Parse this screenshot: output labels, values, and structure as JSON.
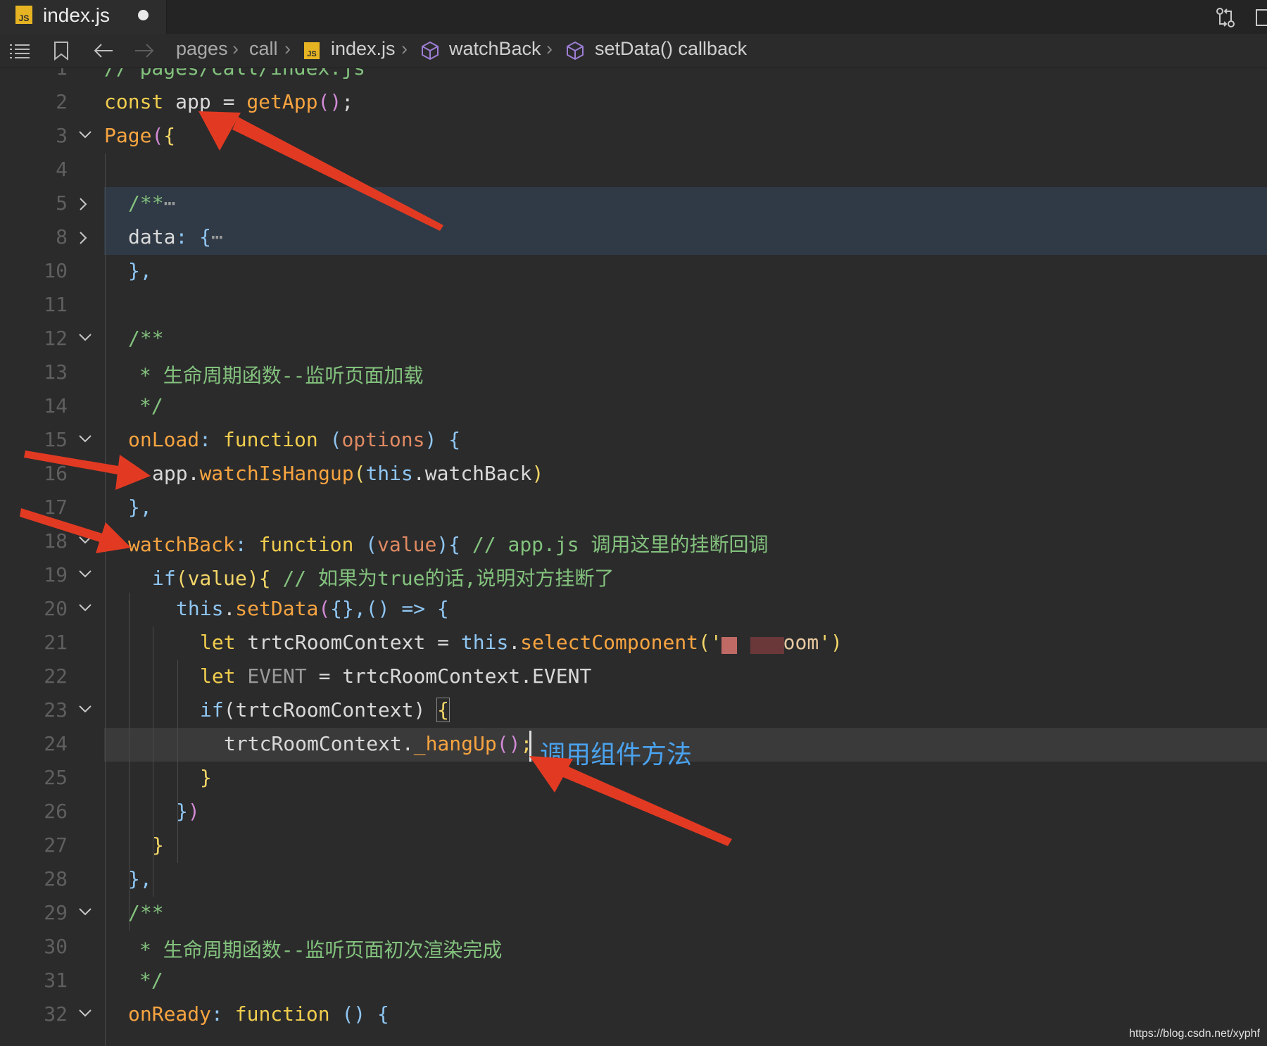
{
  "tab": {
    "file_icon": "JS",
    "file_name": "index.js",
    "modified": true
  },
  "breadcrumb": {
    "path": [
      "pages",
      "call"
    ],
    "file_icon": "JS",
    "file": "index.js",
    "symbol_1": "watchBack",
    "symbol_2": "setData() callback"
  },
  "editor": {
    "lines": [
      {
        "n": "1",
        "text": "// pages/call/index.js"
      },
      {
        "n": "2",
        "text": "const app = getApp();"
      },
      {
        "n": "3",
        "text": "Page({"
      },
      {
        "n": "4",
        "text": ""
      },
      {
        "n": "5",
        "text": "/**…"
      },
      {
        "n": "8",
        "text": "data: {…"
      },
      {
        "n": "10",
        "text": "},"
      },
      {
        "n": "11",
        "text": ""
      },
      {
        "n": "12",
        "text": "/**"
      },
      {
        "n": "13",
        "text": "* 生命周期函数--监听页面加载"
      },
      {
        "n": "14",
        "text": "*/"
      },
      {
        "n": "15",
        "text": "onLoad: function (options) {"
      },
      {
        "n": "16",
        "text": "app.watchIsHangup(this.watchBack)"
      },
      {
        "n": "17",
        "text": "},"
      },
      {
        "n": "18",
        "text": "watchBack: function (value){ // app.js 调用这里的挂断回调"
      },
      {
        "n": "19",
        "text": "if(value){ // 如果为true的话,说明对方挂断了"
      },
      {
        "n": "20",
        "text": "this.setData({},() => {"
      },
      {
        "n": "21",
        "text": "let trtcRoomContext = this.selectComponent('room')"
      },
      {
        "n": "22",
        "text": "let EVENT = trtcRoomContext.EVENT"
      },
      {
        "n": "23",
        "text": "if(trtcRoomContext) {"
      },
      {
        "n": "24",
        "text": "trtcRoomContext._hangUp();"
      },
      {
        "n": "25",
        "text": "}"
      },
      {
        "n": "26",
        "text": "})"
      },
      {
        "n": "27",
        "text": "}"
      },
      {
        "n": "28",
        "text": "},"
      },
      {
        "n": "29",
        "text": "/**"
      },
      {
        "n": "30",
        "text": "* 生命周期函数--监听页面初次渲染完成"
      },
      {
        "n": "31",
        "text": "*/"
      },
      {
        "n": "32",
        "text": "onReady: function () {"
      }
    ],
    "annotation": "调用组件方法"
  },
  "tokens": {
    "l1": "// pages/call/index.js",
    "l2_const": "const",
    "l2_app": " app = ",
    "l2_fn": "getApp",
    "l2_paren": "()",
    "l2_semi": ";",
    "l3_page": "Page",
    "l3_paren": "(",
    "l3_brace": "{",
    "l5": "/**",
    "l5_ell": "⋯",
    "l8_key": "data",
    "l8_colon": ": ",
    "l8_brace": "{",
    "l8_ell": "⋯",
    "l10": "},",
    "l12": "/**",
    "l13": "* 生命周期函数--监听页面加载",
    "l14": "*/",
    "l15_key": "onLoad",
    "l15_colon": ": ",
    "l15_fn": "function",
    "l15_p1": " (",
    "l15_param": "options",
    "l15_p2": ") ",
    "l15_brace": "{",
    "l16_app": "app.",
    "l16_fn": "watchIsHangup",
    "l16_p1": "(",
    "l16_this": "this",
    "l16_rest": ".watchBack",
    "l16_p2": ")",
    "l17": "},",
    "l18_key": "watchBack",
    "l18_colon": ": ",
    "l18_fn": "function",
    "l18_p1": " (",
    "l18_param": "value",
    "l18_p2": "){ ",
    "l18_cm": "// app.js 调用这里的挂断回调",
    "l19_if": "if",
    "l19_p": "(value)",
    "l19_b": "{ ",
    "l19_cm": "// 如果为true的话,说明对方挂断了",
    "l20_this": "this",
    "l20_dot": ".",
    "l20_fn": "setData",
    "l20_rest1": "(",
    "l20_rest2": "{},",
    "l20_rest3": "() => ",
    "l20_b": "{",
    "l21_let": "let",
    "l21_var": " trtcRoomContext = ",
    "l21_this": "this",
    "l21_dot": ".",
    "l21_fn": "selectComponent",
    "l21_p1": "('",
    "l21_str": "room",
    "l21_p2": "')",
    "l22_let": "let",
    "l22_ev": " EVENT",
    "l22_rest": " = trtcRoomContext.EVENT",
    "l23_if": "if",
    "l23_p": "(trtcRoomContext) ",
    "l23_b": "{",
    "l24_obj": "trtcRoomContext.",
    "l24_fn": "_hangUp",
    "l24_p": "()",
    "l24_semi": ";",
    "l25": "}",
    "l26_b": "}",
    "l26_p": ")",
    "l27": "}",
    "l28": "},",
    "l29": "/**",
    "l30": "* 生命周期函数--监听页面初次渲染完成",
    "l31": "*/",
    "l32_key": "onReady",
    "l32_colon": ": ",
    "l32_fn": "function",
    "l32_p": " () ",
    "l32_b": "{"
  },
  "watermark": "https://blog.csdn.net/xyphf",
  "icons": {
    "list": "list-icon",
    "bookmark": "bookmark-icon",
    "back": "arrow-left-icon",
    "forward": "arrow-right-icon",
    "compare": "compare-changes-icon",
    "split": "split-editor-icon",
    "symbol": "cube-icon",
    "fold_open": "chevron-down-icon",
    "fold_closed": "chevron-right-icon"
  },
  "colors": {
    "accent_annotation": "#4aa3ef",
    "arrow": "#e23a22",
    "keyword": "#f1cd4e",
    "comment": "#83c27d"
  }
}
